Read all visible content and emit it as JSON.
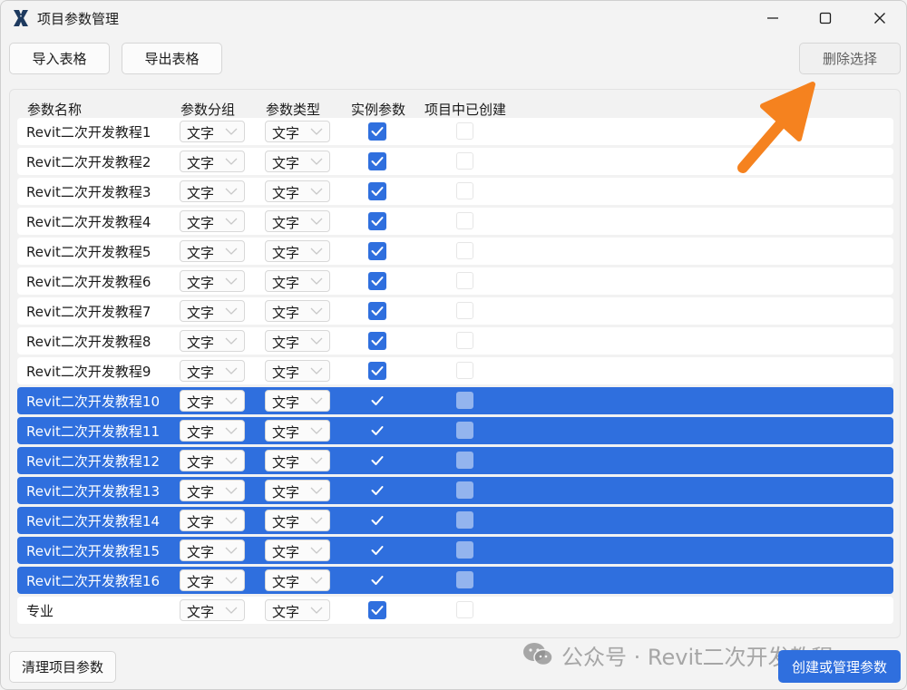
{
  "window": {
    "title": "项目参数管理"
  },
  "toolbar": {
    "import_label": "导入表格",
    "export_label": "导出表格",
    "delete_label": "删除选择"
  },
  "columns": [
    "参数名称",
    "参数分组",
    "参数类型",
    "实例参数",
    "项目中已创建"
  ],
  "rows": [
    {
      "name": "Revit二次开发教程1",
      "group": "文字",
      "type": "文字",
      "instance": true,
      "created": false,
      "selected": false
    },
    {
      "name": "Revit二次开发教程2",
      "group": "文字",
      "type": "文字",
      "instance": true,
      "created": false,
      "selected": false
    },
    {
      "name": "Revit二次开发教程3",
      "group": "文字",
      "type": "文字",
      "instance": true,
      "created": false,
      "selected": false
    },
    {
      "name": "Revit二次开发教程4",
      "group": "文字",
      "type": "文字",
      "instance": true,
      "created": false,
      "selected": false
    },
    {
      "name": "Revit二次开发教程5",
      "group": "文字",
      "type": "文字",
      "instance": true,
      "created": false,
      "selected": false
    },
    {
      "name": "Revit二次开发教程6",
      "group": "文字",
      "type": "文字",
      "instance": true,
      "created": false,
      "selected": false
    },
    {
      "name": "Revit二次开发教程7",
      "group": "文字",
      "type": "文字",
      "instance": true,
      "created": false,
      "selected": false
    },
    {
      "name": "Revit二次开发教程8",
      "group": "文字",
      "type": "文字",
      "instance": true,
      "created": false,
      "selected": false
    },
    {
      "name": "Revit二次开发教程9",
      "group": "文字",
      "type": "文字",
      "instance": true,
      "created": false,
      "selected": false
    },
    {
      "name": "Revit二次开发教程10",
      "group": "文字",
      "type": "文字",
      "instance": true,
      "created": false,
      "selected": true
    },
    {
      "name": "Revit二次开发教程11",
      "group": "文字",
      "type": "文字",
      "instance": true,
      "created": false,
      "selected": true
    },
    {
      "name": "Revit二次开发教程12",
      "group": "文字",
      "type": "文字",
      "instance": true,
      "created": false,
      "selected": true
    },
    {
      "name": "Revit二次开发教程13",
      "group": "文字",
      "type": "文字",
      "instance": true,
      "created": false,
      "selected": true
    },
    {
      "name": "Revit二次开发教程14",
      "group": "文字",
      "type": "文字",
      "instance": true,
      "created": false,
      "selected": true
    },
    {
      "name": "Revit二次开发教程15",
      "group": "文字",
      "type": "文字",
      "instance": true,
      "created": false,
      "selected": true
    },
    {
      "name": "Revit二次开发教程16",
      "group": "文字",
      "type": "文字",
      "instance": true,
      "created": false,
      "selected": true
    },
    {
      "name": "专业",
      "group": "文字",
      "type": "文字",
      "instance": true,
      "created": false,
      "selected": false
    }
  ],
  "footer": {
    "clean_label": "清理项目参数",
    "create_label": "创建或管理参数"
  },
  "watermark": {
    "text": "公众号 · Revit二次开发教程"
  },
  "colors": {
    "accent": "#2f6fde",
    "annotation_arrow": "#f5821f"
  },
  "icons": [
    "app-logo-icon",
    "minimize-icon",
    "maximize-icon",
    "close-icon",
    "chevron-down-icon",
    "checkmark-icon",
    "wechat-icon"
  ]
}
